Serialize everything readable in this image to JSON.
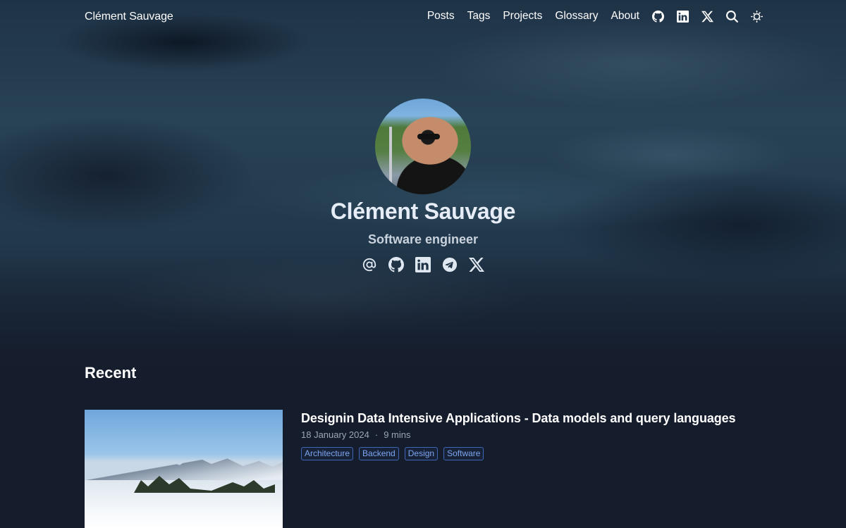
{
  "header": {
    "brand": "Clément Sauvage",
    "nav": [
      "Posts",
      "Tags",
      "Projects",
      "Glossary",
      "About"
    ],
    "icons": [
      "github-icon",
      "linkedin-icon",
      "x-icon",
      "search-icon",
      "theme-toggle-icon"
    ]
  },
  "profile": {
    "name": "Clément Sauvage",
    "role": "Software engineer",
    "socials": [
      "email-icon",
      "github-icon",
      "linkedin-icon",
      "telegram-icon",
      "x-icon"
    ]
  },
  "recent": {
    "title": "Recent",
    "posts": [
      {
        "title": "Designin Data Intensive Applications - Data models and query languages",
        "date": "18 January 2024",
        "separator": "·",
        "read_time": "9 mins",
        "tags": [
          "Architecture",
          "Backend",
          "Design",
          "Software"
        ]
      }
    ]
  },
  "colors": {
    "background": "#151c2b",
    "tag_text": "#7ea6f0",
    "tag_border": "#3e67b8"
  }
}
